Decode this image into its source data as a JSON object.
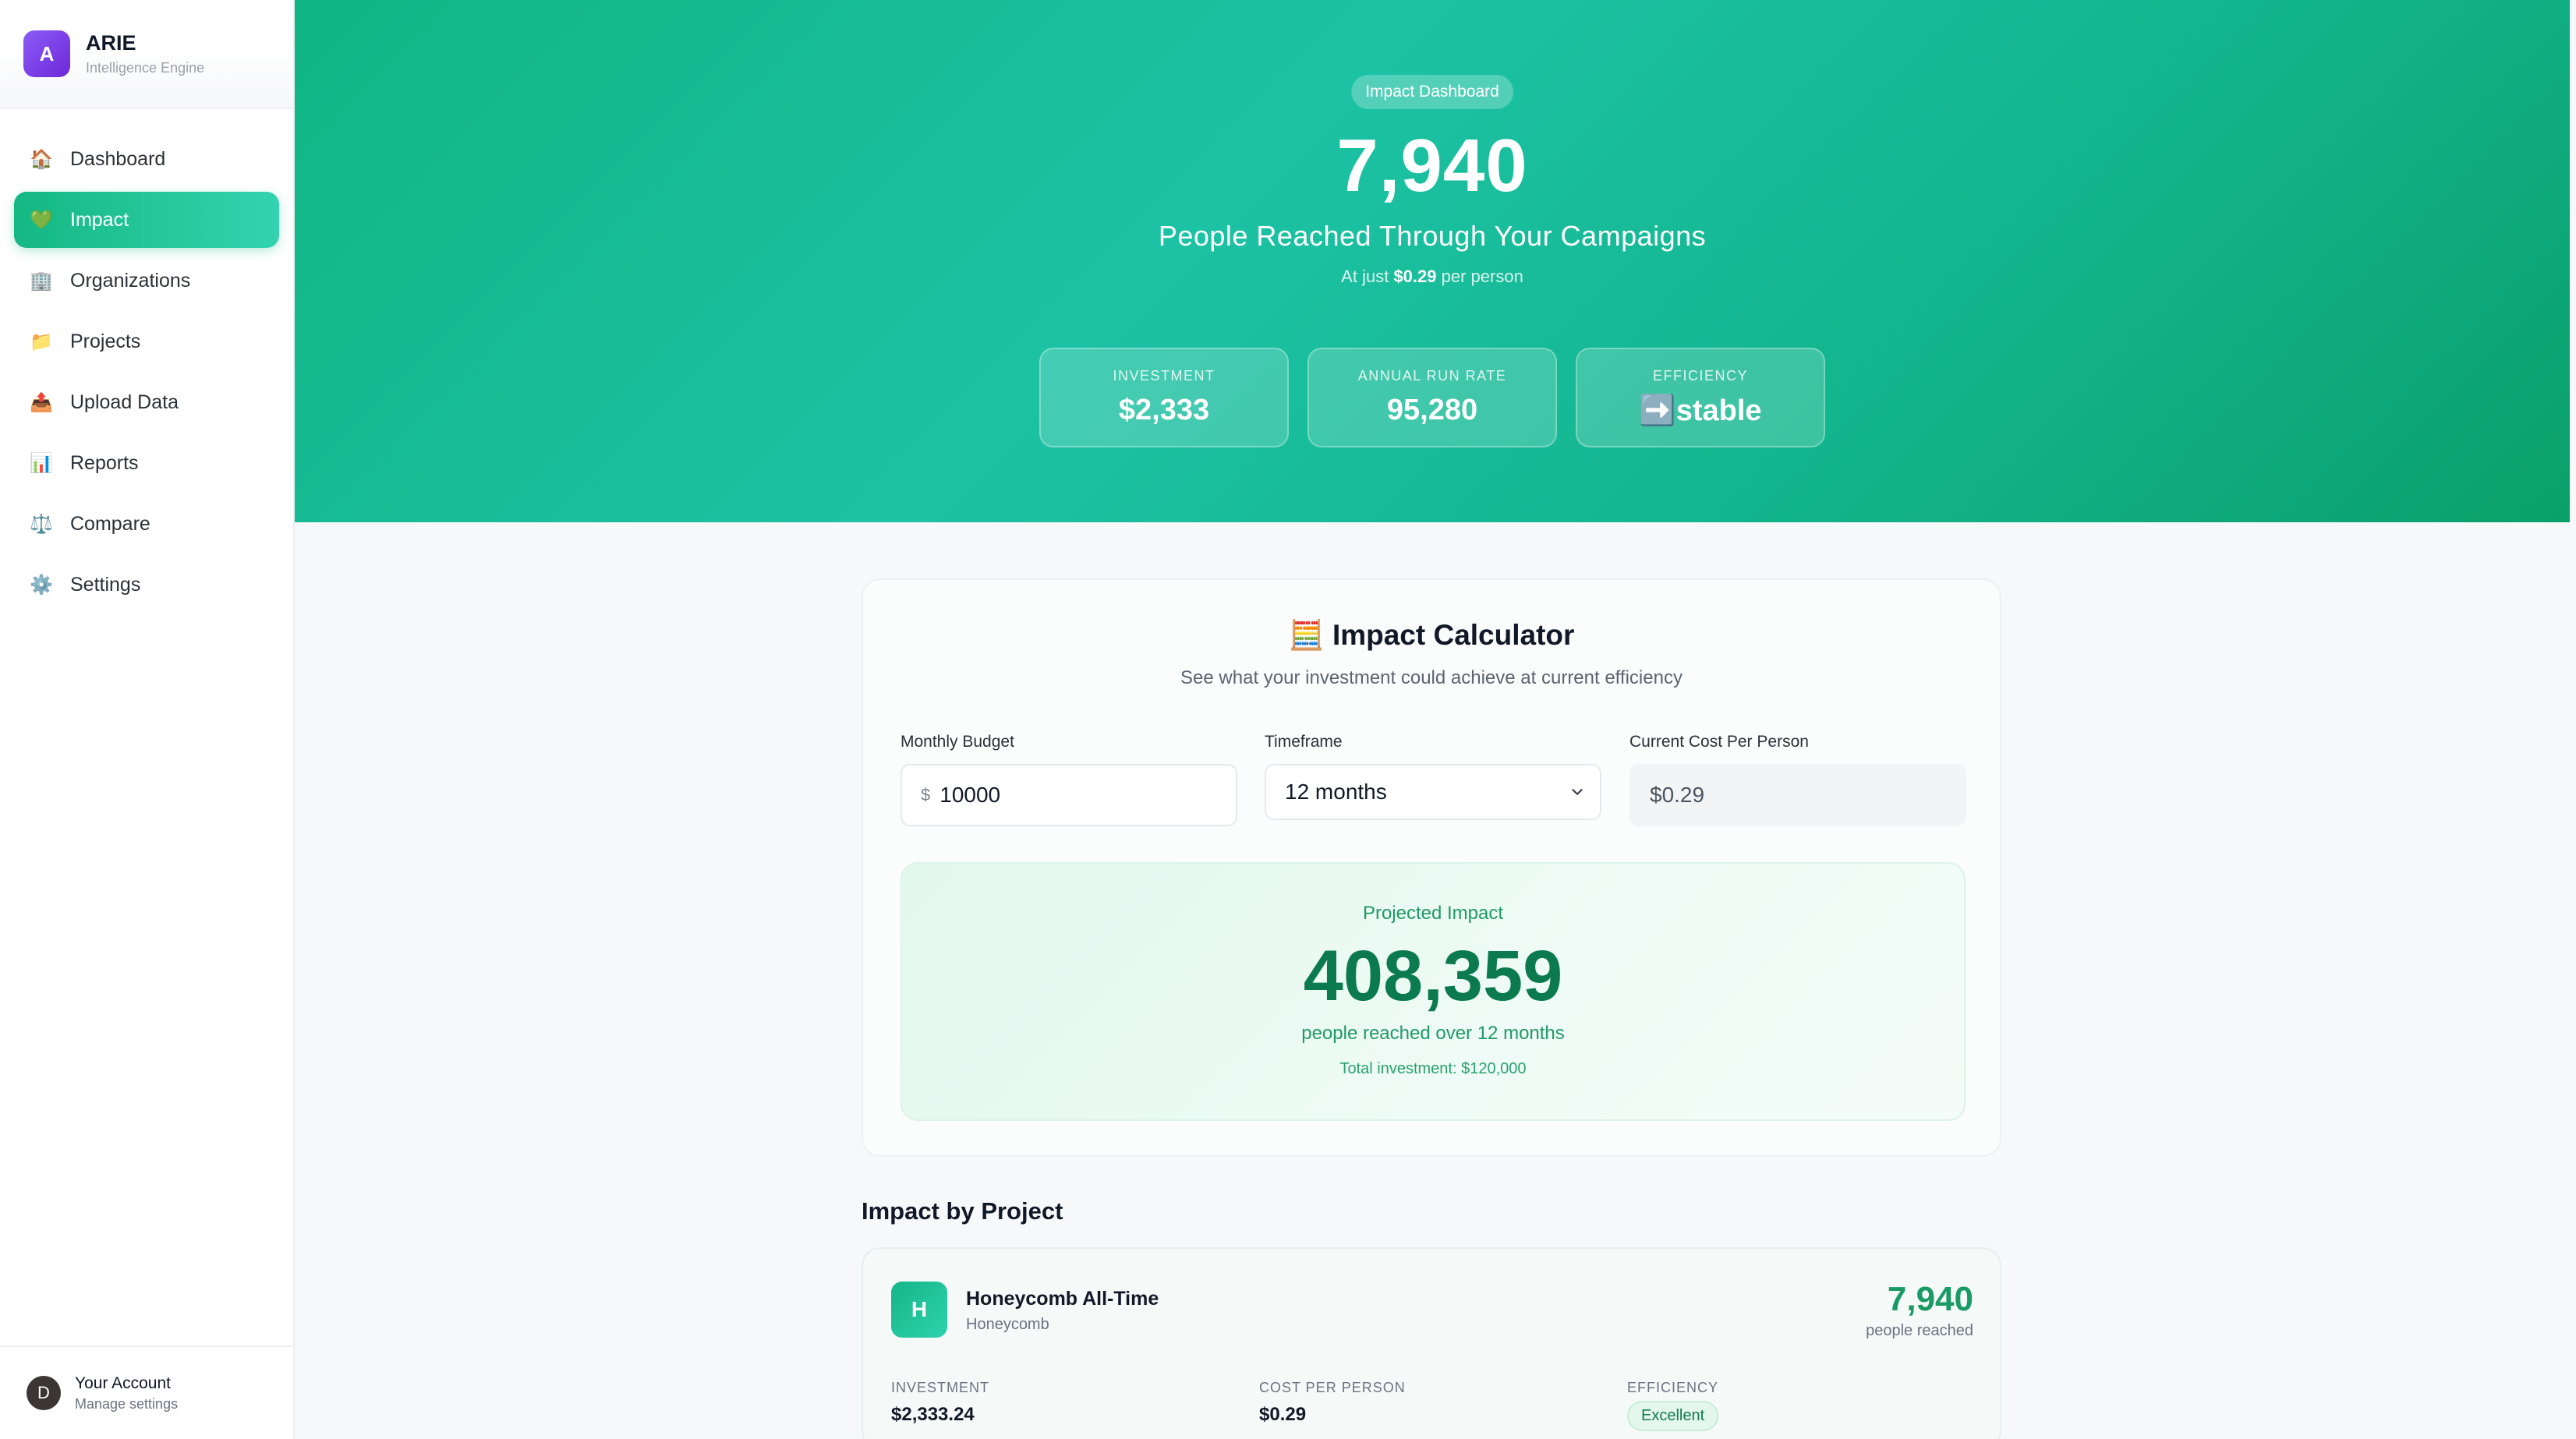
{
  "sidebar": {
    "brand": {
      "logo": "A",
      "name": "ARIE",
      "subtitle": "Intelligence Engine"
    },
    "items": [
      {
        "icon": "🏠",
        "icon_name": "house-icon",
        "label": "Dashboard",
        "active": false
      },
      {
        "icon": "💚",
        "icon_name": "heart-icon",
        "label": "Impact",
        "active": true
      },
      {
        "icon": "🏢",
        "icon_name": "building-icon",
        "label": "Organizations",
        "active": false
      },
      {
        "icon": "📁",
        "icon_name": "folder-icon",
        "label": "Projects",
        "active": false
      },
      {
        "icon": "📤",
        "icon_name": "upload-icon",
        "label": "Upload Data",
        "active": false
      },
      {
        "icon": "📊",
        "icon_name": "bar-chart-icon",
        "label": "Reports",
        "active": false
      },
      {
        "icon": "⚖️",
        "icon_name": "scales-icon",
        "label": "Compare",
        "active": false
      },
      {
        "icon": "⚙️",
        "icon_name": "gear-icon",
        "label": "Settings",
        "active": false
      }
    ],
    "account": {
      "initial": "D",
      "name": "Your Account",
      "subtitle": "Manage settings"
    }
  },
  "hero": {
    "badge": "Impact Dashboard",
    "people_reached": "7,940",
    "title": "People Reached Through Your Campaigns",
    "cost_prefix": "At just",
    "cost_value": "$0.29",
    "cost_suffix": "per person",
    "stats": [
      {
        "label": "INVESTMENT",
        "value": "$2,333"
      },
      {
        "label": "ANNUAL RUN RATE",
        "value": "95,280"
      },
      {
        "label": "EFFICIENCY",
        "value": "➡️stable"
      }
    ]
  },
  "calculator": {
    "icon": "🧮",
    "title": "Impact Calculator",
    "subtitle": "See what your investment could achieve at current efficiency",
    "monthly_budget": {
      "label": "Monthly Budget",
      "currency": "$",
      "value": "10000"
    },
    "timeframe": {
      "label": "Timeframe",
      "value": "12 months"
    },
    "cost_per_person": {
      "label": "Current Cost Per Person",
      "value": "$0.29"
    },
    "projected": {
      "label": "Projected Impact",
      "value": "408,359",
      "subtitle": "people reached over 12 months",
      "total": "Total investment: $120,000"
    }
  },
  "projects": {
    "title": "Impact by Project",
    "items": [
      {
        "initial": "H",
        "name": "Honeycomb All-Time",
        "org": "Honeycomb",
        "reached": "7,940",
        "reached_label": "people reached",
        "investment_label": "INVESTMENT",
        "investment": "$2,333.24",
        "cost_label": "COST PER PERSON",
        "cost": "$0.29",
        "efficiency_label": "EFFICIENCY",
        "efficiency": "Excellent"
      }
    ]
  },
  "colors": {
    "accent": "#14b882",
    "brand": "#7c3aed",
    "projected_text": "#0b7a4f"
  }
}
